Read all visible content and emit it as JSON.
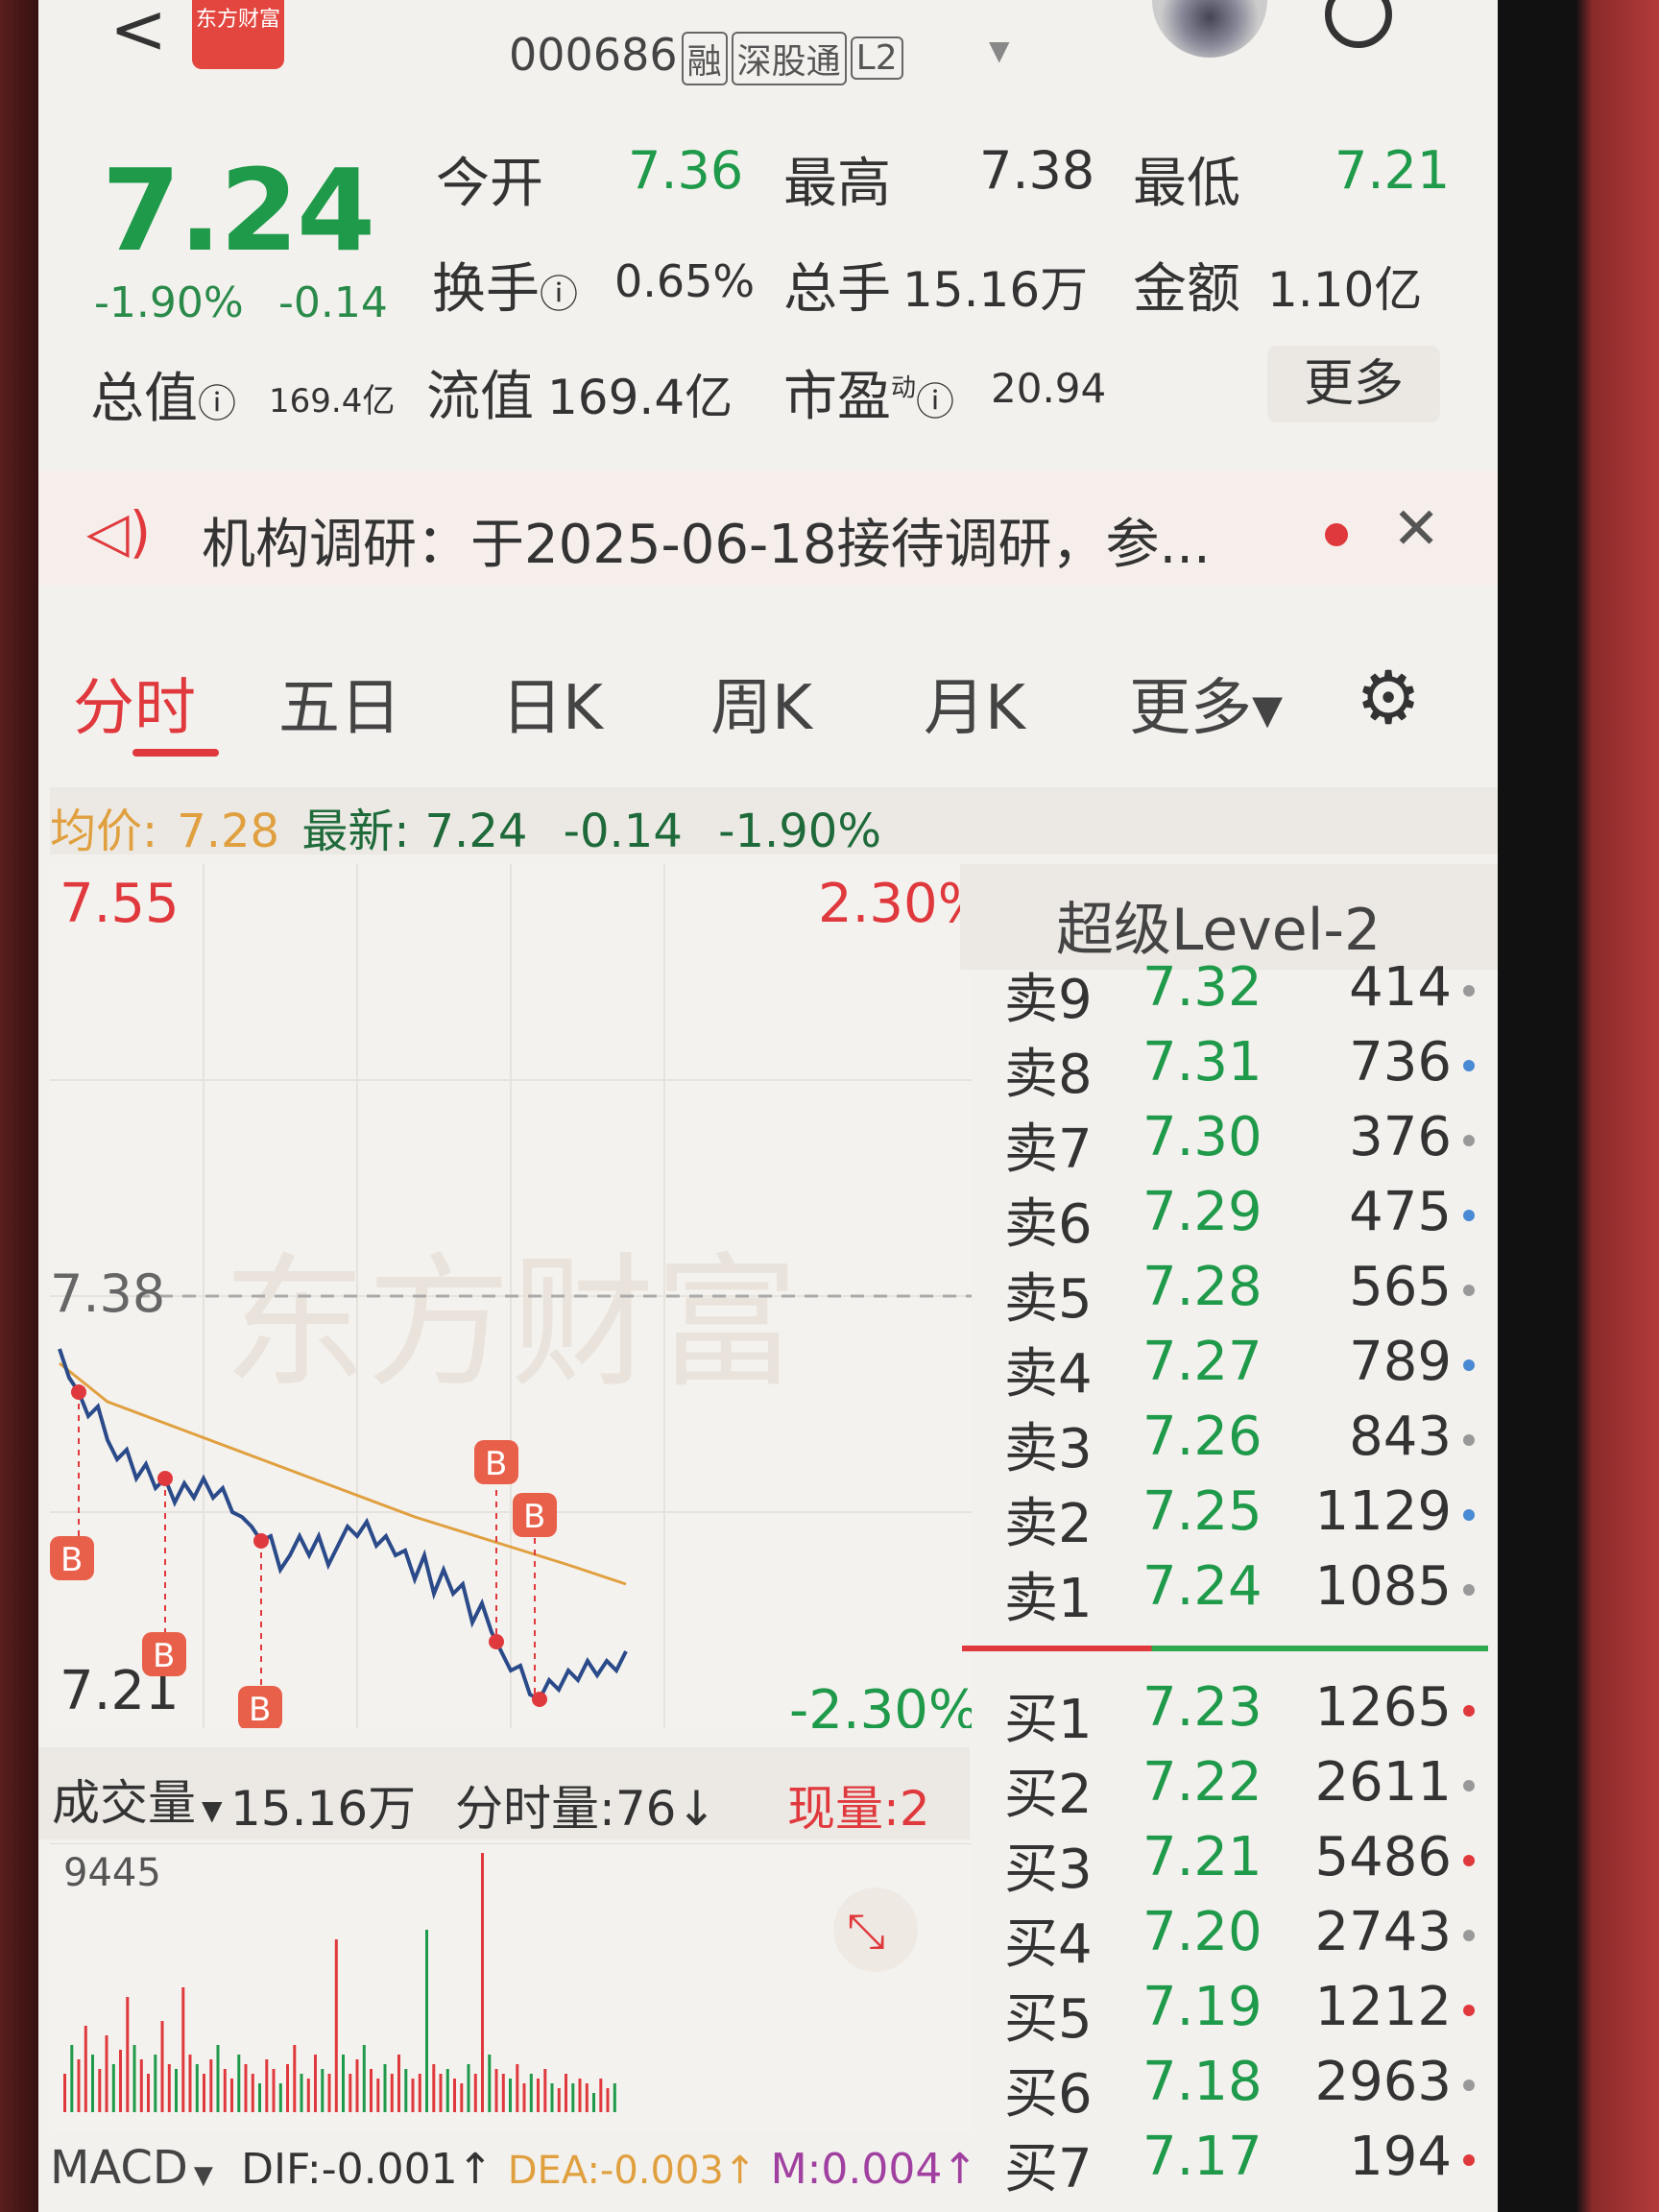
{
  "header": {
    "back_glyph": "<",
    "logo_text": "东方财富",
    "code": "000686",
    "tags": [
      "融",
      "深股通",
      "L2"
    ],
    "dropdown_glyph": "▼"
  },
  "quote": {
    "price": "7.24",
    "change_pct": "-1.90%",
    "change_val": "-0.14",
    "open_label": "今开",
    "open": "7.36",
    "high_label": "最高",
    "high": "7.38",
    "low_label": "最低",
    "low": "7.21",
    "turnover_label": "换手",
    "turnover": "0.65%",
    "volume_label": "总手",
    "volume": "15.16万",
    "amount_label": "金额",
    "amount": "1.10亿",
    "mktcap_label": "总值",
    "mktcap": "169.4亿",
    "float_label": "流值",
    "float_cap": "169.4亿",
    "pe_label": "市盈",
    "pe_sup": "动",
    "pe": "20.94",
    "more_label": "更多"
  },
  "notice": {
    "text": "机构调研：于2025-06-18接待调研，参...",
    "close_glyph": "✕"
  },
  "tabs": [
    "分时",
    "五日",
    "日K",
    "周K",
    "月K",
    "更多▾"
  ],
  "info_row": {
    "avg_label": "均价:",
    "avg": "7.28",
    "latest_label": "最新:",
    "latest": "7.24",
    "chg": "-0.14",
    "pct": "-1.90%"
  },
  "chart": {
    "y_top": "7.55",
    "y_mid": "7.38",
    "y_bottom": "7.21",
    "pct_top": "2.30%",
    "pct_bottom": "-2.30%",
    "marker": "B",
    "watermark": "东方财富"
  },
  "volume_bar": {
    "label": "成交量",
    "total": "15.16万",
    "period_label": "分时量:76↓",
    "current_label": "现量:2",
    "max": "9445"
  },
  "macd": {
    "label": "MACD",
    "dif": "DIF:-0.001↑",
    "dea": "DEA:-0.003↑",
    "m": "M:0.004↑"
  },
  "level2": {
    "title": "超级Level-2",
    "asks": [
      {
        "side": "卖9",
        "price": "7.32",
        "qty": "414"
      },
      {
        "side": "卖8",
        "price": "7.31",
        "qty": "736"
      },
      {
        "side": "卖7",
        "price": "7.30",
        "qty": "376"
      },
      {
        "side": "卖6",
        "price": "7.29",
        "qty": "475"
      },
      {
        "side": "卖5",
        "price": "7.28",
        "qty": "565"
      },
      {
        "side": "卖4",
        "price": "7.27",
        "qty": "789"
      },
      {
        "side": "卖3",
        "price": "7.26",
        "qty": "843"
      },
      {
        "side": "卖2",
        "price": "7.25",
        "qty": "1129"
      },
      {
        "side": "卖1",
        "price": "7.24",
        "qty": "1085"
      }
    ],
    "bids": [
      {
        "side": "买1",
        "price": "7.23",
        "qty": "1265"
      },
      {
        "side": "买2",
        "price": "7.22",
        "qty": "2611"
      },
      {
        "side": "买3",
        "price": "7.21",
        "qty": "5486"
      },
      {
        "side": "买4",
        "price": "7.20",
        "qty": "2743"
      },
      {
        "side": "买5",
        "price": "7.19",
        "qty": "1212"
      },
      {
        "side": "买6",
        "price": "7.18",
        "qty": "2963"
      },
      {
        "side": "买7",
        "price": "7.17",
        "qty": "194"
      }
    ]
  },
  "colors": {
    "up": "#e0393d",
    "down": "#1f9a4a",
    "avg_line": "#e0a040",
    "price_line": "#2a4a8a"
  }
}
